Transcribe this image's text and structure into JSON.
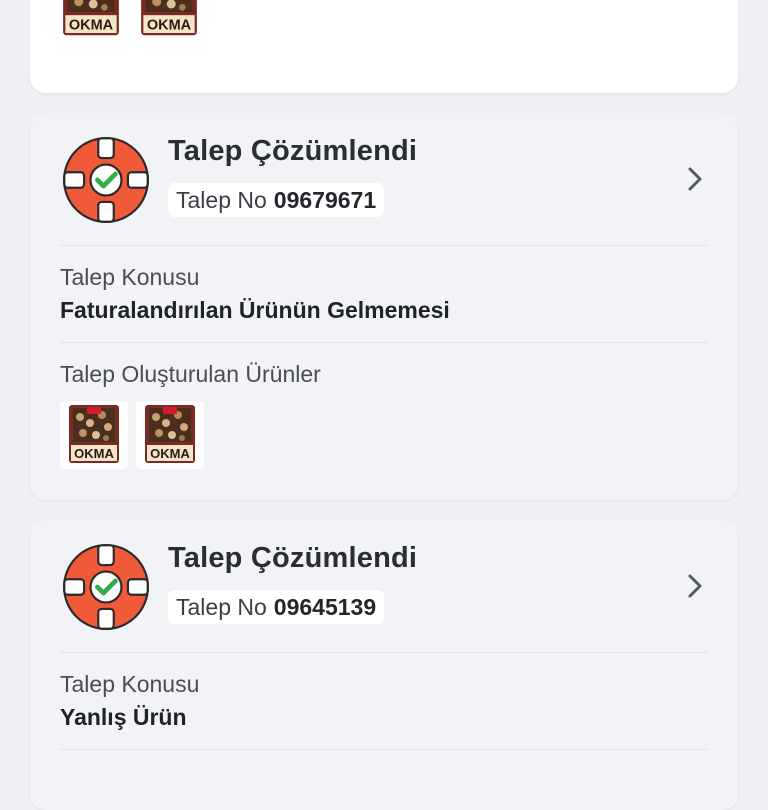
{
  "top_card": {
    "product_thumbnails": [
      {
        "name": "product-thumbnail-1",
        "label": "OKMA"
      },
      {
        "name": "product-thumbnail-2",
        "label": "OKMA"
      }
    ]
  },
  "tickets": [
    {
      "status_title": "Talep Çözümlendi",
      "ticket_no_label": "Talep No",
      "ticket_no": "09679671",
      "subject_label": "Talep Konusu",
      "subject": "Faturalandırılan Ürünün Gelmemesi",
      "products_label": "Talep Oluşturulan Ürünler",
      "products": [
        {
          "label": "OKMA"
        },
        {
          "label": "OKMA"
        }
      ]
    },
    {
      "status_title": "Talep Çözümlendi",
      "ticket_no_label": "Talep No",
      "ticket_no": "09645139",
      "subject_label": "Talep Konusu",
      "subject": "Yanlış Ürün"
    }
  ],
  "icons": {
    "status": "lifebuoy-check-icon",
    "chevron": "chevron-right-icon"
  },
  "colors": {
    "lifebuoy_ring": "#f05a38",
    "check": "#2fae4a",
    "background": "#eef0f4"
  }
}
